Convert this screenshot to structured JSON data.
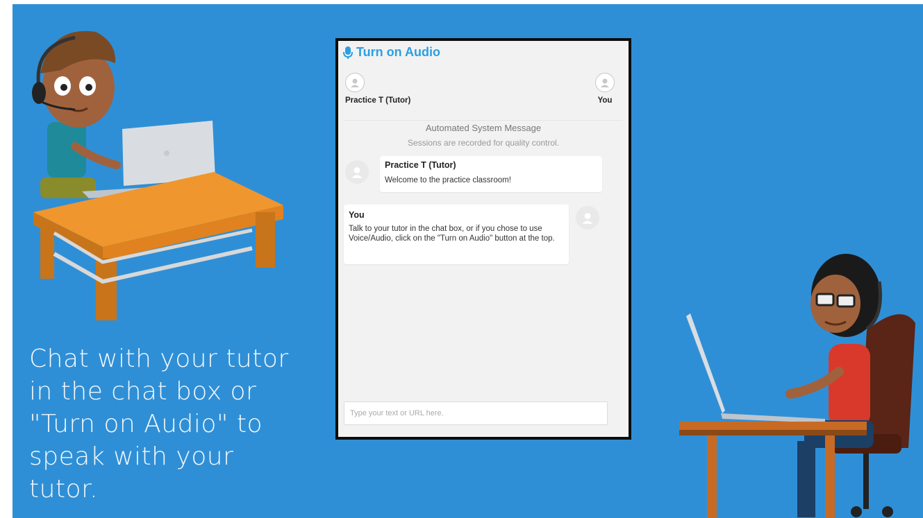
{
  "caption": "Chat with your tutor\nin the chat box or\n\"Turn on Audio\" to\nspeak with your\ntutor.",
  "chat": {
    "audio_button": "Turn on Audio",
    "participants": [
      {
        "name": "Practice T (Tutor)"
      },
      {
        "name": "You"
      }
    ],
    "system_message": {
      "title": "Automated System Message",
      "text": "Sessions are recorded for quality control."
    },
    "messages": [
      {
        "sender": "Practice T (Tutor)",
        "text": "Welcome to the practice classroom!"
      },
      {
        "sender": "You",
        "text": "Talk to your tutor in the chat box, or if you chose to use Voice/Audio, click on the \"Turn on Audio\" button at the top."
      }
    ],
    "input_placeholder": "Type your text or URL here."
  },
  "colors": {
    "background": "#2f8fd6",
    "accent": "#2a9fe2"
  },
  "icons": [
    "microphone-icon",
    "user-avatar-icon"
  ]
}
